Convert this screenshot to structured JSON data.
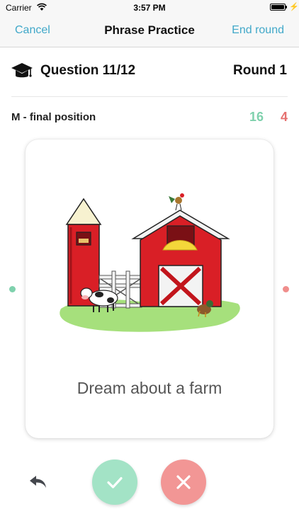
{
  "status_bar": {
    "carrier": "Carrier",
    "time": "3:57 PM"
  },
  "nav": {
    "cancel_label": "Cancel",
    "title": "Phrase Practice",
    "end_label": "End round"
  },
  "question": {
    "label": "Question 11/12",
    "round": "Round 1"
  },
  "sound": {
    "label": "M - final position"
  },
  "score": {
    "correct": "16",
    "wrong": "4"
  },
  "card": {
    "text": "Dream about a farm",
    "illustration": "farm-illustration"
  },
  "colors": {
    "accent": "#41a8c9",
    "correct": "#7fd1ad",
    "wrong": "#e5706f",
    "correct_button": "#a3e3c6",
    "wrong_button": "#f29695"
  },
  "icons": {
    "question": "graduation-cap-icon",
    "undo": "undo-icon",
    "correct": "checkmark-icon",
    "wrong": "x-icon"
  }
}
